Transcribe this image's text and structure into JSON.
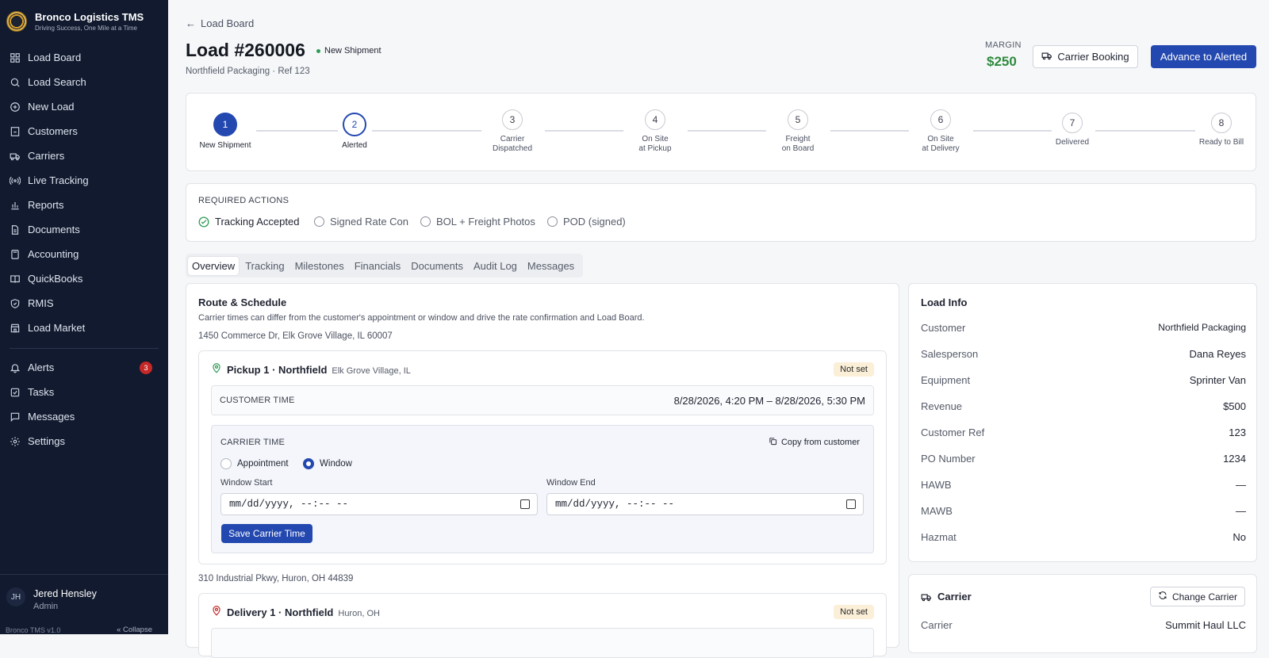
{
  "app": {
    "name": "Bronco Logistics TMS",
    "tagline": "Driving Success, One Mile at a Time",
    "version": "Bronco TMS v1.0",
    "collapse": "Collapse"
  },
  "nav": [
    {
      "label": "Load Board",
      "icon": "grid"
    },
    {
      "label": "Load Search",
      "icon": "search"
    },
    {
      "label": "New Load",
      "icon": "plus-circle"
    },
    {
      "label": "Customers",
      "icon": "building"
    },
    {
      "label": "Carriers",
      "icon": "truck"
    },
    {
      "label": "Live Tracking",
      "icon": "broadcast"
    },
    {
      "label": "Reports",
      "icon": "bar-chart"
    },
    {
      "label": "Documents",
      "icon": "file"
    },
    {
      "label": "Accounting",
      "icon": "calculator"
    },
    {
      "label": "QuickBooks",
      "icon": "book"
    },
    {
      "label": "RMIS",
      "icon": "shield"
    },
    {
      "label": "Load Market",
      "icon": "store"
    }
  ],
  "nav2": [
    {
      "label": "Alerts",
      "icon": "bell",
      "badge": "3"
    },
    {
      "label": "Tasks",
      "icon": "check-square"
    },
    {
      "label": "Messages",
      "icon": "message"
    },
    {
      "label": "Settings",
      "icon": "gear"
    }
  ],
  "user": {
    "initials": "JH",
    "name": "Jered Hensley",
    "role": "Admin"
  },
  "header": {
    "back": "Load Board",
    "title": "Load #260006",
    "status": "New Shipment",
    "subtitle": "Northfield Packaging · Ref 123",
    "margin_label": "MARGIN",
    "margin_value": "$250",
    "carrier_booking": "Carrier Booking",
    "advance": "Advance to Alerted"
  },
  "steps": [
    {
      "n": "1",
      "l1": "New Shipment",
      "l2": "",
      "state": "done"
    },
    {
      "n": "2",
      "l1": "Alerted",
      "l2": "",
      "state": "current"
    },
    {
      "n": "3",
      "l1": "Carrier",
      "l2": "Dispatched",
      "state": "todo"
    },
    {
      "n": "4",
      "l1": "On Site",
      "l2": "at Pickup",
      "state": "todo"
    },
    {
      "n": "5",
      "l1": "Freight",
      "l2": "on Board",
      "state": "todo"
    },
    {
      "n": "6",
      "l1": "On Site",
      "l2": "at Delivery",
      "state": "todo"
    },
    {
      "n": "7",
      "l1": "Delivered",
      "l2": "",
      "state": "todo"
    },
    {
      "n": "8",
      "l1": "Ready to Bill",
      "l2": "",
      "state": "todo"
    }
  ],
  "required": {
    "title": "REQUIRED ACTIONS",
    "items": [
      {
        "label": "Tracking Accepted",
        "done": true
      },
      {
        "label": "Signed Rate Con",
        "done": false
      },
      {
        "label": "BOL + Freight Photos",
        "done": false
      },
      {
        "label": "POD (signed)",
        "done": false
      }
    ]
  },
  "tabs": [
    "Overview",
    "Tracking",
    "Milestones",
    "Financials",
    "Documents",
    "Audit Log",
    "Messages"
  ],
  "route": {
    "title": "Route & Schedule",
    "desc": "Carrier times can differ from the customer's appointment or window and drive the rate confirmation and Load Board.",
    "pickup_address": "1450 Commerce Dr, Elk Grove Village, IL 60007",
    "pickup": {
      "title": "Pickup 1 · Northfield",
      "loc": "Elk Grove Village, IL",
      "status": "Not set",
      "customer_time_label": "CUSTOMER TIME",
      "customer_time": "8/28/2026, 4:20 PM – 8/28/2026, 5:30 PM",
      "carrier_time_label": "CARRIER TIME",
      "copy": "Copy from customer",
      "opt_appt": "Appointment",
      "opt_window": "Window",
      "window_start_label": "Window Start",
      "window_end_label": "Window End",
      "placeholder": "mm/dd/yyyy, --:-- --",
      "save": "Save Carrier Time"
    },
    "delivery_address": "310 Industrial Pkwy, Huron, OH 44839",
    "delivery": {
      "title": "Delivery 1 · Northfield",
      "loc": "Huron, OH",
      "status": "Not set"
    }
  },
  "load_info": {
    "title": "Load Info",
    "rows": [
      {
        "k": "Customer",
        "v": "Northfield Packaging"
      },
      {
        "k": "Salesperson",
        "v": "Dana Reyes"
      },
      {
        "k": "Equipment",
        "v": "Sprinter Van"
      },
      {
        "k": "Revenue",
        "v": "$500"
      },
      {
        "k": "Customer Ref",
        "v": "123"
      },
      {
        "k": "PO Number",
        "v": "1234"
      },
      {
        "k": "HAWB",
        "v": "—"
      },
      {
        "k": "MAWB",
        "v": "—"
      },
      {
        "k": "Hazmat",
        "v": "No"
      }
    ]
  },
  "carrier": {
    "title": "Carrier",
    "change": "Change Carrier",
    "label": "Carrier",
    "value": "Summit Haul LLC"
  }
}
